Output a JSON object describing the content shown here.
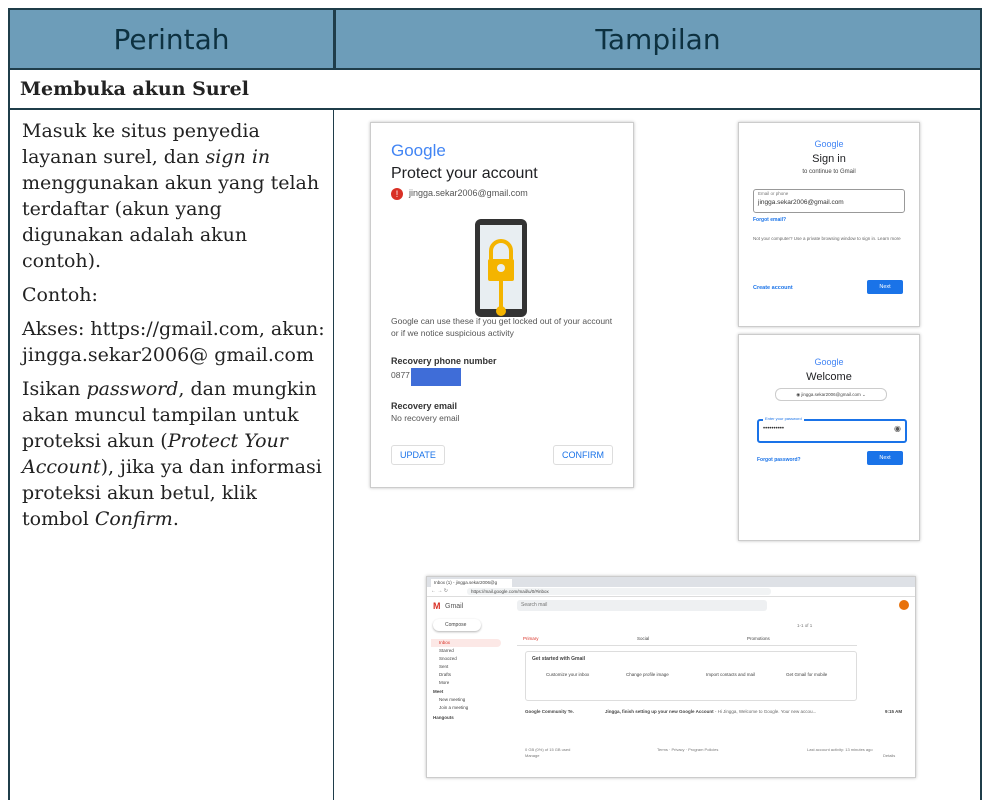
{
  "table": {
    "header_left": "Perintah",
    "header_right": "Tampilan",
    "section_title": "Membuka akun Surel"
  },
  "instructions": {
    "p1_a": "Masuk ke situs penyedia layanan surel, dan ",
    "p1_em": "sign in",
    "p1_b": " menggunakan akun yang telah terdaftar (akun yang digunakan adalah akun contoh).",
    "p2": "Contoh:",
    "p3": "Akses:  https://gmail.com, akun: jingga.sekar2006@ gmail.com",
    "p4_a": "Isikan ",
    "p4_em": "password",
    "p4_b": ", dan mungkin akan muncul tampilan untuk proteksi akun (",
    "p4_em2": "Protect Your Account",
    "p4_c": "), jika ya dan informasi proteksi akun betul, klik tombol ",
    "p4_em3": "Confirm",
    "p4_d": "."
  },
  "protect": {
    "logo": "Google",
    "title": "Protect your account",
    "email": "jingga.sekar2006@gmail.com",
    "desc": "Google can use these if you get locked out of your account or if we notice suspicious activity",
    "phone_label": "Recovery phone number",
    "phone_value": "0877",
    "email_label": "Recovery email",
    "email_value": "No recovery email",
    "update": "UPDATE",
    "confirm": "CONFIRM"
  },
  "signin": {
    "logo": "Google",
    "title": "Sign in",
    "subtitle": "to continue to Gmail",
    "field_label": "Email or phone",
    "field_value": "jingga.sekar2006@gmail.com",
    "forgot": "Forgot email?",
    "guest_note": "Not your computer? Use a private browsing window to sign in. Learn more",
    "create": "Create account",
    "next": "Next"
  },
  "welcome": {
    "logo": "Google",
    "title": "Welcome",
    "account": "jingga.sekar2006@gmail.com",
    "field_label": "Enter your password",
    "field_value": "••••••••••",
    "forgot": "Forgot password?",
    "next": "Next"
  },
  "gmail": {
    "tab": "Inbox (1) - jingga.sekar2006@g",
    "url": "https://mail.google.com/mail/u/0/#inbox",
    "app_name": "Gmail",
    "search_placeholder": "Search mail",
    "compose": "Compose",
    "nav": [
      "Inbox",
      "Starred",
      "Snoozed",
      "Sent",
      "Drafts",
      "More"
    ],
    "meet_label": "Meet",
    "meet": [
      "New meeting",
      "Join a meeting"
    ],
    "hangouts": "Hangouts",
    "tabs": [
      "Primary",
      "Social",
      "Promotions"
    ],
    "started_title": "Get started with Gmail",
    "started_items": [
      "Customize your inbox",
      "Change profile image",
      "Import contacts and mail",
      "Get Gmail for mobile"
    ],
    "mail_sender": "Google Community Te.",
    "mail_subject": "Jingga, finish setting up your new Google Account",
    "mail_snippet": " - Hi Jingga, Welcome to Google. Your new accou...",
    "mail_time": "9:15 AM",
    "pagination": "1-1 of 1",
    "footer_storage": "0 GB (0%) of 15 GB used",
    "footer_manage": "Manage",
    "footer_links": "Terms · Privacy · Program Policies",
    "footer_activity": "Last account activity: 13 minutes ago",
    "footer_details": "Details",
    "colors": {
      "accent": "#1a73e8",
      "red": "#d93025"
    }
  }
}
